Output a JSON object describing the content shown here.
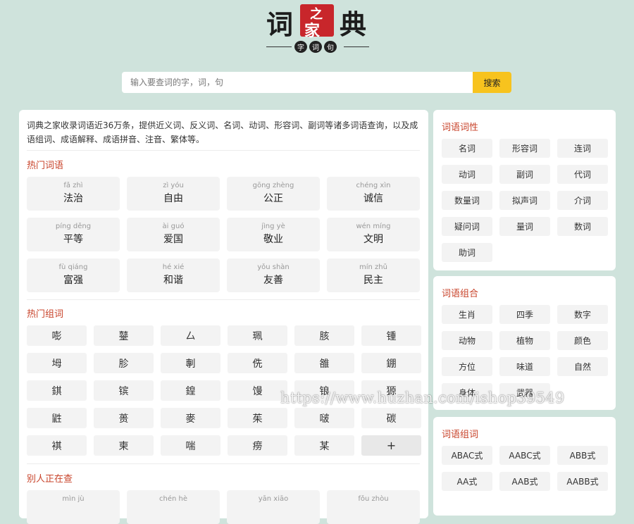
{
  "logo": {
    "char_left": "词",
    "char_red_top": "之",
    "char_red_bottom": "家",
    "char_right": "典",
    "sub_chars": [
      "字",
      "词",
      "句"
    ]
  },
  "search": {
    "placeholder": "输入要查词的字，词，句",
    "button_label": "搜索"
  },
  "intro": "词典之家收录词语近36万条，提供近义词、反义词、名词、动词、形容词、副词等诸多词语查询，以及成语组词、成语解释、成语拼音、注音、繁体等。",
  "hot_words": {
    "title": "热门词语",
    "items": [
      {
        "pinyin": "fǎ zhì",
        "word": "法治"
      },
      {
        "pinyin": "zì yóu",
        "word": "自由"
      },
      {
        "pinyin": "gōng zhèng",
        "word": "公正"
      },
      {
        "pinyin": "chéng xìn",
        "word": "诚信"
      },
      {
        "pinyin": "píng děng",
        "word": "平等"
      },
      {
        "pinyin": "ài guó",
        "word": "爱国"
      },
      {
        "pinyin": "jìng yè",
        "word": "敬业"
      },
      {
        "pinyin": "wén míng",
        "word": "文明"
      },
      {
        "pinyin": "fù qiáng",
        "word": "富强"
      },
      {
        "pinyin": "hé xié",
        "word": "和谐"
      },
      {
        "pinyin": "yǒu shàn",
        "word": "友善"
      },
      {
        "pinyin": "mín zhǔ",
        "word": "民主"
      }
    ]
  },
  "hot_chars": {
    "title": "热门组词",
    "items": [
      "嘭",
      "鼞",
      "厶",
      "珮",
      "胲",
      "锺",
      "坶",
      "胗",
      "剸",
      "侁",
      "雒",
      "錋",
      "錤",
      "镔",
      "鍠",
      "馒",
      "锒",
      "獂",
      "鼪",
      "蒉",
      "麥",
      "茱",
      "啵",
      "碳",
      "褀",
      "柬",
      "喘",
      "痨",
      "某"
    ],
    "more_label": "+"
  },
  "recent": {
    "title": "别人正在查",
    "items": [
      {
        "pinyin": "mìn jù"
      },
      {
        "pinyin": "chén hè"
      },
      {
        "pinyin": "yān xiāo"
      },
      {
        "pinyin": "fǒu zhòu"
      }
    ]
  },
  "pos": {
    "title": "词语词性",
    "items": [
      "名词",
      "形容词",
      "连词",
      "动词",
      "副词",
      "代词",
      "数量词",
      "拟声词",
      "介词",
      "疑问词",
      "量词",
      "数词",
      "助词"
    ]
  },
  "combo": {
    "title": "词语组合",
    "items": [
      "生肖",
      "四季",
      "数字",
      "动物",
      "植物",
      "颜色",
      "方位",
      "味道",
      "自然",
      "身体",
      "武器"
    ]
  },
  "pattern": {
    "title": "词语组词",
    "items": [
      "ABAC式",
      "AABC式",
      "ABB式",
      "AA式",
      "AAB式",
      "AABB式"
    ]
  },
  "watermark": "https://www.huzhan.com/ishop39549"
}
